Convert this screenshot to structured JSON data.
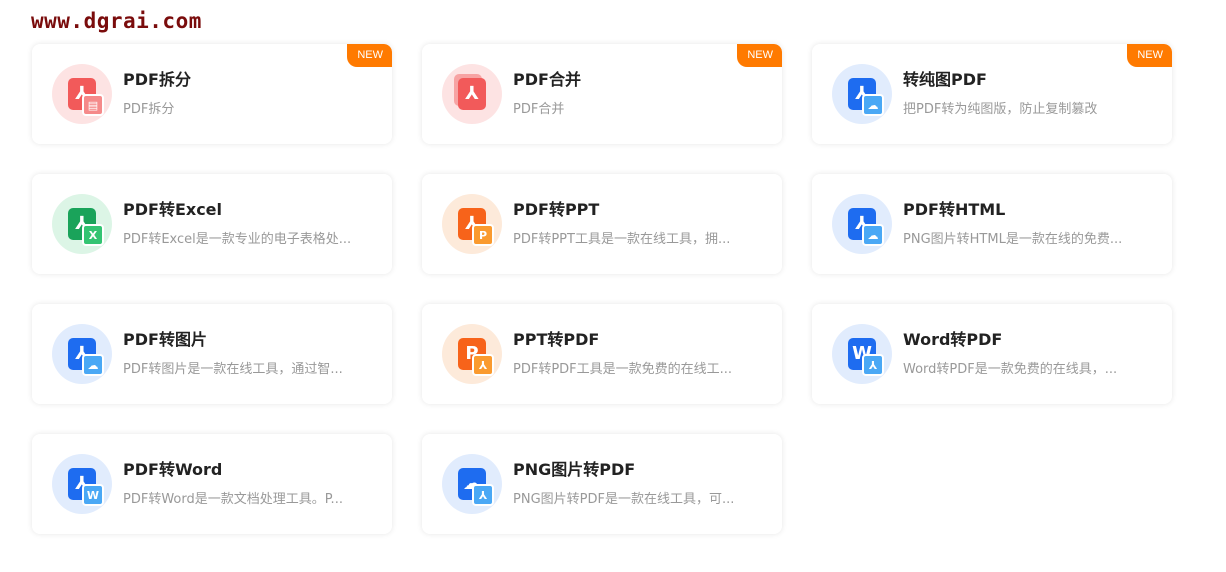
{
  "watermark": "www.dgrai.com",
  "new_label": "NEW",
  "colors": {
    "new_tag": "#ff7a00",
    "red": "#f25a5a",
    "blue": "#1e6cf0",
    "green": "#1aa35a",
    "orange": "#f77a1a"
  },
  "cards": [
    {
      "title": "PDF拆分",
      "desc": "PDF拆分",
      "icon": "pdf-split-icon",
      "is_new": true
    },
    {
      "title": "PDF合并",
      "desc": "PDF合并",
      "icon": "pdf-merge-icon",
      "is_new": true
    },
    {
      "title": "转纯图PDF",
      "desc": "把PDF转为纯图版，防止复制篡改",
      "icon": "pdf-to-image-pdf-icon",
      "is_new": true
    },
    {
      "title": "PDF转Excel",
      "desc": "PDF转Excel是一款专业的电子表格处...",
      "icon": "pdf-to-excel-icon",
      "is_new": false
    },
    {
      "title": "PDF转PPT",
      "desc": "PDF转PPT工具是一款在线工具，拥...",
      "icon": "pdf-to-ppt-icon",
      "is_new": false
    },
    {
      "title": "PDF转HTML",
      "desc": "PNG图片转HTML是一款在线的免费...",
      "icon": "pdf-to-html-icon",
      "is_new": false
    },
    {
      "title": "PDF转图片",
      "desc": "PDF转图片是一款在线工具，通过智...",
      "icon": "pdf-to-image-icon",
      "is_new": false
    },
    {
      "title": "PPT转PDF",
      "desc": "PDF转PDF工具是一款免费的在线工...",
      "icon": "ppt-to-pdf-icon",
      "is_new": false
    },
    {
      "title": "Word转PDF",
      "desc": "Word转PDF是一款免费的在线具，...",
      "icon": "word-to-pdf-icon",
      "is_new": false
    },
    {
      "title": "PDF转Word",
      "desc": "PDF转Word是一款文档处理工具。P...",
      "icon": "pdf-to-word-icon",
      "is_new": false
    },
    {
      "title": "PNG图片转PDF",
      "desc": "PNG图片转PDF是一款在线工具，可...",
      "icon": "png-to-pdf-icon",
      "is_new": false
    }
  ]
}
